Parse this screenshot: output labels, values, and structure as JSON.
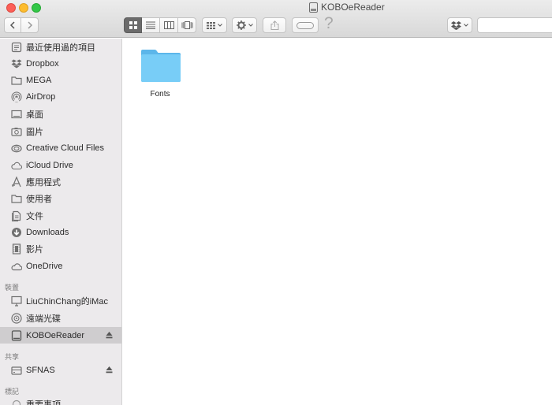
{
  "window": {
    "title": "KOBOeReader"
  },
  "toolbar": {
    "back_icon": "chevron-left-icon",
    "forward_icon": "chevron-right-icon",
    "help_label": "?",
    "search_placeholder": ""
  },
  "sidebar": {
    "favorites": [
      {
        "label": "最近使用過的項目",
        "icon": "recents-icon"
      },
      {
        "label": "Dropbox",
        "icon": "dropbox-icon"
      },
      {
        "label": "MEGA",
        "icon": "folder-icon"
      },
      {
        "label": "AirDrop",
        "icon": "airdrop-icon"
      },
      {
        "label": "桌面",
        "icon": "desktop-icon"
      },
      {
        "label": "圖片",
        "icon": "camera-icon"
      },
      {
        "label": "Creative Cloud Files",
        "icon": "creative-cloud-icon"
      },
      {
        "label": "iCloud Drive",
        "icon": "cloud-icon"
      },
      {
        "label": "應用程式",
        "icon": "applications-icon"
      },
      {
        "label": "使用者",
        "icon": "folder-icon"
      },
      {
        "label": "文件",
        "icon": "documents-icon"
      },
      {
        "label": "Downloads",
        "icon": "download-icon"
      },
      {
        "label": "影片",
        "icon": "film-icon"
      },
      {
        "label": "OneDrive",
        "icon": "cloud-icon"
      }
    ],
    "devices_header": "裝置",
    "devices": [
      {
        "label": "LiuChinChang的iMac",
        "icon": "imac-icon"
      },
      {
        "label": "遠端光碟",
        "icon": "disc-icon"
      },
      {
        "label": "KOBOeReader",
        "icon": "drive-icon",
        "selected": true,
        "eject": true
      }
    ],
    "shared_header": "共享",
    "shared": [
      {
        "label": "SFNAS",
        "icon": "server-icon",
        "eject": true
      }
    ],
    "tags_header": "標記",
    "tags": [
      {
        "label": "重要事項",
        "icon": "tag-icon"
      }
    ]
  },
  "main": {
    "items": [
      {
        "label": "Fonts",
        "icon": "folder-icon",
        "color": "#6cc5f5"
      }
    ]
  },
  "colors": {
    "selection": "#cfcdcf",
    "folder": "#6cc5f5",
    "close": "#fc5f57",
    "minimize": "#fdbc2e",
    "maximize": "#33c748"
  }
}
